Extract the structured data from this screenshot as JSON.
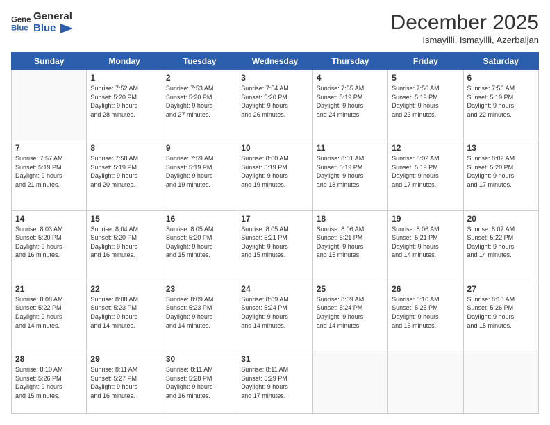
{
  "logo": {
    "line1": "General",
    "line2": "Blue"
  },
  "header": {
    "month": "December 2025",
    "location": "Ismayilli, Ismayilli, Azerbaijan"
  },
  "days": [
    "Sunday",
    "Monday",
    "Tuesday",
    "Wednesday",
    "Thursday",
    "Friday",
    "Saturday"
  ],
  "weeks": [
    [
      {
        "day": "",
        "info": ""
      },
      {
        "day": "1",
        "info": "Sunrise: 7:52 AM\nSunset: 5:20 PM\nDaylight: 9 hours\nand 28 minutes."
      },
      {
        "day": "2",
        "info": "Sunrise: 7:53 AM\nSunset: 5:20 PM\nDaylight: 9 hours\nand 27 minutes."
      },
      {
        "day": "3",
        "info": "Sunrise: 7:54 AM\nSunset: 5:20 PM\nDaylight: 9 hours\nand 26 minutes."
      },
      {
        "day": "4",
        "info": "Sunrise: 7:55 AM\nSunset: 5:19 PM\nDaylight: 9 hours\nand 24 minutes."
      },
      {
        "day": "5",
        "info": "Sunrise: 7:56 AM\nSunset: 5:19 PM\nDaylight: 9 hours\nand 23 minutes."
      },
      {
        "day": "6",
        "info": "Sunrise: 7:56 AM\nSunset: 5:19 PM\nDaylight: 9 hours\nand 22 minutes."
      }
    ],
    [
      {
        "day": "7",
        "info": "Sunrise: 7:57 AM\nSunset: 5:19 PM\nDaylight: 9 hours\nand 21 minutes."
      },
      {
        "day": "8",
        "info": "Sunrise: 7:58 AM\nSunset: 5:19 PM\nDaylight: 9 hours\nand 20 minutes."
      },
      {
        "day": "9",
        "info": "Sunrise: 7:59 AM\nSunset: 5:19 PM\nDaylight: 9 hours\nand 19 minutes."
      },
      {
        "day": "10",
        "info": "Sunrise: 8:00 AM\nSunset: 5:19 PM\nDaylight: 9 hours\nand 19 minutes."
      },
      {
        "day": "11",
        "info": "Sunrise: 8:01 AM\nSunset: 5:19 PM\nDaylight: 9 hours\nand 18 minutes."
      },
      {
        "day": "12",
        "info": "Sunrise: 8:02 AM\nSunset: 5:19 PM\nDaylight: 9 hours\nand 17 minutes."
      },
      {
        "day": "13",
        "info": "Sunrise: 8:02 AM\nSunset: 5:20 PM\nDaylight: 9 hours\nand 17 minutes."
      }
    ],
    [
      {
        "day": "14",
        "info": "Sunrise: 8:03 AM\nSunset: 5:20 PM\nDaylight: 9 hours\nand 16 minutes."
      },
      {
        "day": "15",
        "info": "Sunrise: 8:04 AM\nSunset: 5:20 PM\nDaylight: 9 hours\nand 16 minutes."
      },
      {
        "day": "16",
        "info": "Sunrise: 8:05 AM\nSunset: 5:20 PM\nDaylight: 9 hours\nand 15 minutes."
      },
      {
        "day": "17",
        "info": "Sunrise: 8:05 AM\nSunset: 5:21 PM\nDaylight: 9 hours\nand 15 minutes."
      },
      {
        "day": "18",
        "info": "Sunrise: 8:06 AM\nSunset: 5:21 PM\nDaylight: 9 hours\nand 15 minutes."
      },
      {
        "day": "19",
        "info": "Sunrise: 8:06 AM\nSunset: 5:21 PM\nDaylight: 9 hours\nand 14 minutes."
      },
      {
        "day": "20",
        "info": "Sunrise: 8:07 AM\nSunset: 5:22 PM\nDaylight: 9 hours\nand 14 minutes."
      }
    ],
    [
      {
        "day": "21",
        "info": "Sunrise: 8:08 AM\nSunset: 5:22 PM\nDaylight: 9 hours\nand 14 minutes."
      },
      {
        "day": "22",
        "info": "Sunrise: 8:08 AM\nSunset: 5:23 PM\nDaylight: 9 hours\nand 14 minutes."
      },
      {
        "day": "23",
        "info": "Sunrise: 8:09 AM\nSunset: 5:23 PM\nDaylight: 9 hours\nand 14 minutes."
      },
      {
        "day": "24",
        "info": "Sunrise: 8:09 AM\nSunset: 5:24 PM\nDaylight: 9 hours\nand 14 minutes."
      },
      {
        "day": "25",
        "info": "Sunrise: 8:09 AM\nSunset: 5:24 PM\nDaylight: 9 hours\nand 14 minutes."
      },
      {
        "day": "26",
        "info": "Sunrise: 8:10 AM\nSunset: 5:25 PM\nDaylight: 9 hours\nand 15 minutes."
      },
      {
        "day": "27",
        "info": "Sunrise: 8:10 AM\nSunset: 5:26 PM\nDaylight: 9 hours\nand 15 minutes."
      }
    ],
    [
      {
        "day": "28",
        "info": "Sunrise: 8:10 AM\nSunset: 5:26 PM\nDaylight: 9 hours\nand 15 minutes."
      },
      {
        "day": "29",
        "info": "Sunrise: 8:11 AM\nSunset: 5:27 PM\nDaylight: 9 hours\nand 16 minutes."
      },
      {
        "day": "30",
        "info": "Sunrise: 8:11 AM\nSunset: 5:28 PM\nDaylight: 9 hours\nand 16 minutes."
      },
      {
        "day": "31",
        "info": "Sunrise: 8:11 AM\nSunset: 5:29 PM\nDaylight: 9 hours\nand 17 minutes."
      },
      {
        "day": "",
        "info": ""
      },
      {
        "day": "",
        "info": ""
      },
      {
        "day": "",
        "info": ""
      }
    ]
  ]
}
